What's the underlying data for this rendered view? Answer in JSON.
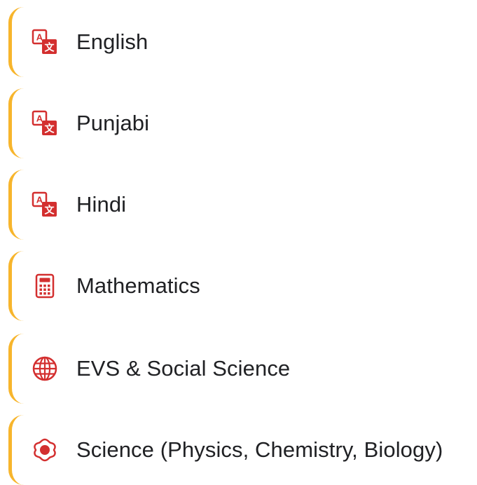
{
  "accent_color": "#F7B52C",
  "icon_color": "#D32F2F",
  "subjects": [
    {
      "label": "English",
      "icon": "translate-icon"
    },
    {
      "label": "Punjabi",
      "icon": "translate-icon"
    },
    {
      "label": "Hindi",
      "icon": "translate-icon"
    },
    {
      "label": "Mathematics",
      "icon": "calculator-icon"
    },
    {
      "label": "EVS & Social Science",
      "icon": "globe-icon"
    },
    {
      "label": "Science (Physics, Chemistry, Biology)",
      "icon": "science-icon"
    }
  ]
}
